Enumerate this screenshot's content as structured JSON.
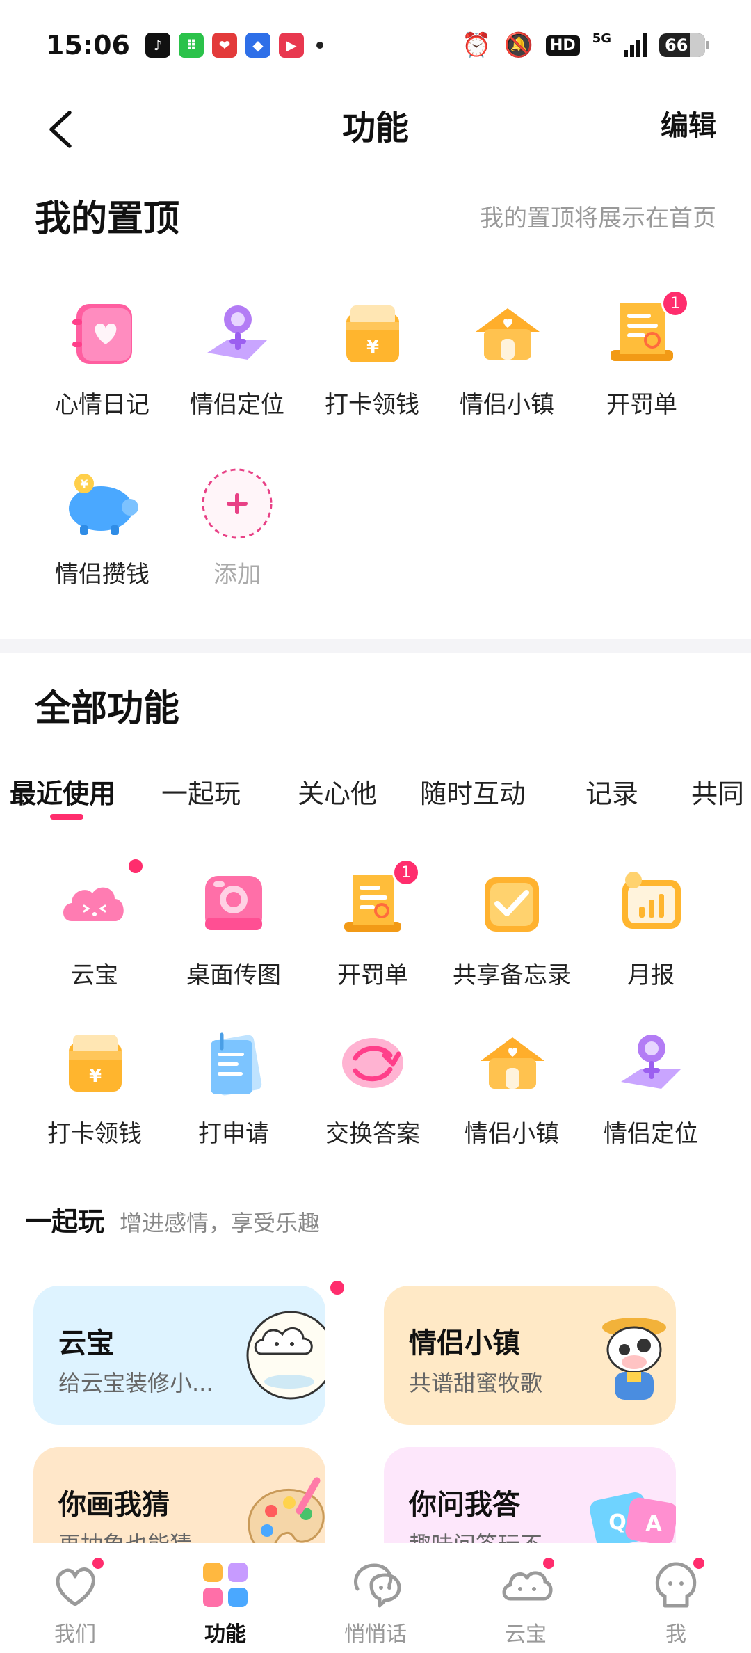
{
  "status_bar": {
    "time": "15:06",
    "battery": "66",
    "hd_label": "HD",
    "network": "5G"
  },
  "nav": {
    "title": "功能",
    "edit": "编辑"
  },
  "pinned": {
    "title": "我的置顶",
    "hint": "我的置顶将展示在首页",
    "items": [
      {
        "label": "心情日记",
        "icon": "mood-diary-icon"
      },
      {
        "label": "情侣定位",
        "icon": "couple-location-icon"
      },
      {
        "label": "打卡领钱",
        "icon": "checkin-reward-icon"
      },
      {
        "label": "情侣小镇",
        "icon": "couple-town-icon"
      },
      {
        "label": "开罚单",
        "icon": "ticket-icon",
        "badge": "1"
      },
      {
        "label": "情侣攒钱",
        "icon": "piggy-bank-icon"
      },
      {
        "label": "添加",
        "icon": "add-icon"
      }
    ]
  },
  "all_features": {
    "title": "全部功能",
    "tabs": [
      "最近使用",
      "一起玩",
      "关心他",
      "随时互动",
      "记录",
      "共同"
    ],
    "recent": [
      {
        "label": "云宝",
        "icon": "cloud-pet-icon",
        "dot": true
      },
      {
        "label": "桌面传图",
        "icon": "camera-icon"
      },
      {
        "label": "开罚单",
        "icon": "ticket-icon",
        "badge": "1"
      },
      {
        "label": "共享备忘录",
        "icon": "memo-icon"
      },
      {
        "label": "月报",
        "icon": "monthly-report-icon"
      },
      {
        "label": "打卡领钱",
        "icon": "checkin-reward-icon"
      },
      {
        "label": "打申请",
        "icon": "application-icon"
      },
      {
        "label": "交换答案",
        "icon": "exchange-icon"
      },
      {
        "label": "情侣小镇",
        "icon": "couple-town-icon"
      },
      {
        "label": "情侣定位",
        "icon": "couple-location-icon"
      }
    ]
  },
  "play_together": {
    "title": "一起玩",
    "desc": "增进感情，享受乐趣",
    "cards": [
      {
        "title": "云宝",
        "sub": "给云宝装修小...",
        "bg": "#def3ff",
        "dot": true
      },
      {
        "title": "情侣小镇",
        "sub": "共谱甜蜜牧歌",
        "bg": "#ffe9c6"
      },
      {
        "title": "你画我猜",
        "sub": "再抽象也能猜",
        "bg": "#ffe7c9"
      },
      {
        "title": "你问我答",
        "sub": "趣味问答玩不",
        "bg": "#fde7fb"
      }
    ]
  },
  "bottom_nav": [
    {
      "label": "我们",
      "icon": "heart-icon",
      "dot": true
    },
    {
      "label": "功能",
      "icon": "grid-icon",
      "active": true
    },
    {
      "label": "悄悄话",
      "icon": "chat-icon"
    },
    {
      "label": "云宝",
      "icon": "cloud-icon",
      "dot": true
    },
    {
      "label": "我",
      "icon": "profile-icon",
      "dot": true
    }
  ],
  "colors": {
    "accent": "#ff2d6d",
    "pink_icon": "#ff6fa8",
    "orange_icon": "#ffb840",
    "purple_icon": "#b57cf0",
    "blue_icon": "#4aa8ff"
  }
}
